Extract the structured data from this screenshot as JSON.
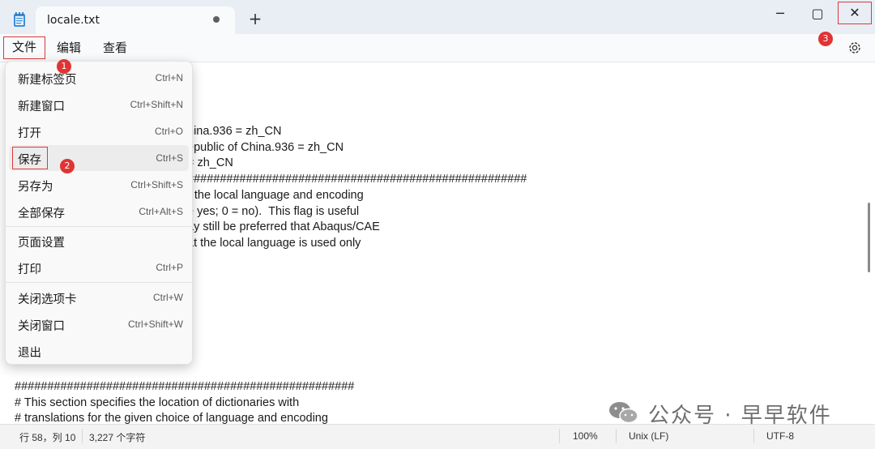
{
  "window": {
    "tab_title": "locale.txt",
    "new_tab_label": "+",
    "minimize_glyph": "─",
    "maximize_glyph": "▢",
    "close_glyph": "✕"
  },
  "menubar": {
    "file": "文件",
    "edit": "编辑",
    "view": "查看"
  },
  "badges": [
    "1",
    "2",
    "3"
  ],
  "file_menu": {
    "items": [
      {
        "label": "新建标签页",
        "shortcut": "Ctrl+N"
      },
      {
        "label": "新建窗口",
        "shortcut": "Ctrl+Shift+N"
      },
      {
        "label": "打开",
        "shortcut": "Ctrl+O"
      },
      {
        "label": "保存",
        "shortcut": "Ctrl+S"
      },
      {
        "label": "另存为",
        "shortcut": "Ctrl+Shift+S"
      },
      {
        "label": "全部保存",
        "shortcut": "Ctrl+Alt+S"
      },
      {
        "label": "页面设置",
        "shortcut": ""
      },
      {
        "label": "打印",
        "shortcut": "Ctrl+P"
      },
      {
        "label": "关闭选项卡",
        "shortcut": "Ctrl+W"
      },
      {
        "label": "关闭窗口",
        "shortcut": "Ctrl+Shift+W"
      },
      {
        "label": "退出",
        "shortcut": ""
      }
    ]
  },
  "editor": {
    "lines": [
      "hina.936 = zh_CN",
      "epublic of China.936 = zh_CN",
      "= zh_CN",
      "####################################################",
      "r the local language and encoding",
      "e yes; 0 = no).  This flag is useful",
      "ay still be preferred that Abaqus/CAE",
      "at the local language is used only",
      "####################################################",
      "# This section specifies the location of dictionaries with",
      "# translations for the given choice of language and encoding"
    ]
  },
  "statusbar": {
    "position": "行 58，列 10",
    "char_count": "3,227 个字符",
    "zoom": "100%",
    "line_ending": "Unix (LF)",
    "encoding": "UTF-8"
  },
  "watermark": {
    "text": "公众号 · 早早软件"
  },
  "colors": {
    "highlight_red": "#d93b3b",
    "badge_red": "#e03434",
    "titlebar_bg": "#e9eef5"
  }
}
